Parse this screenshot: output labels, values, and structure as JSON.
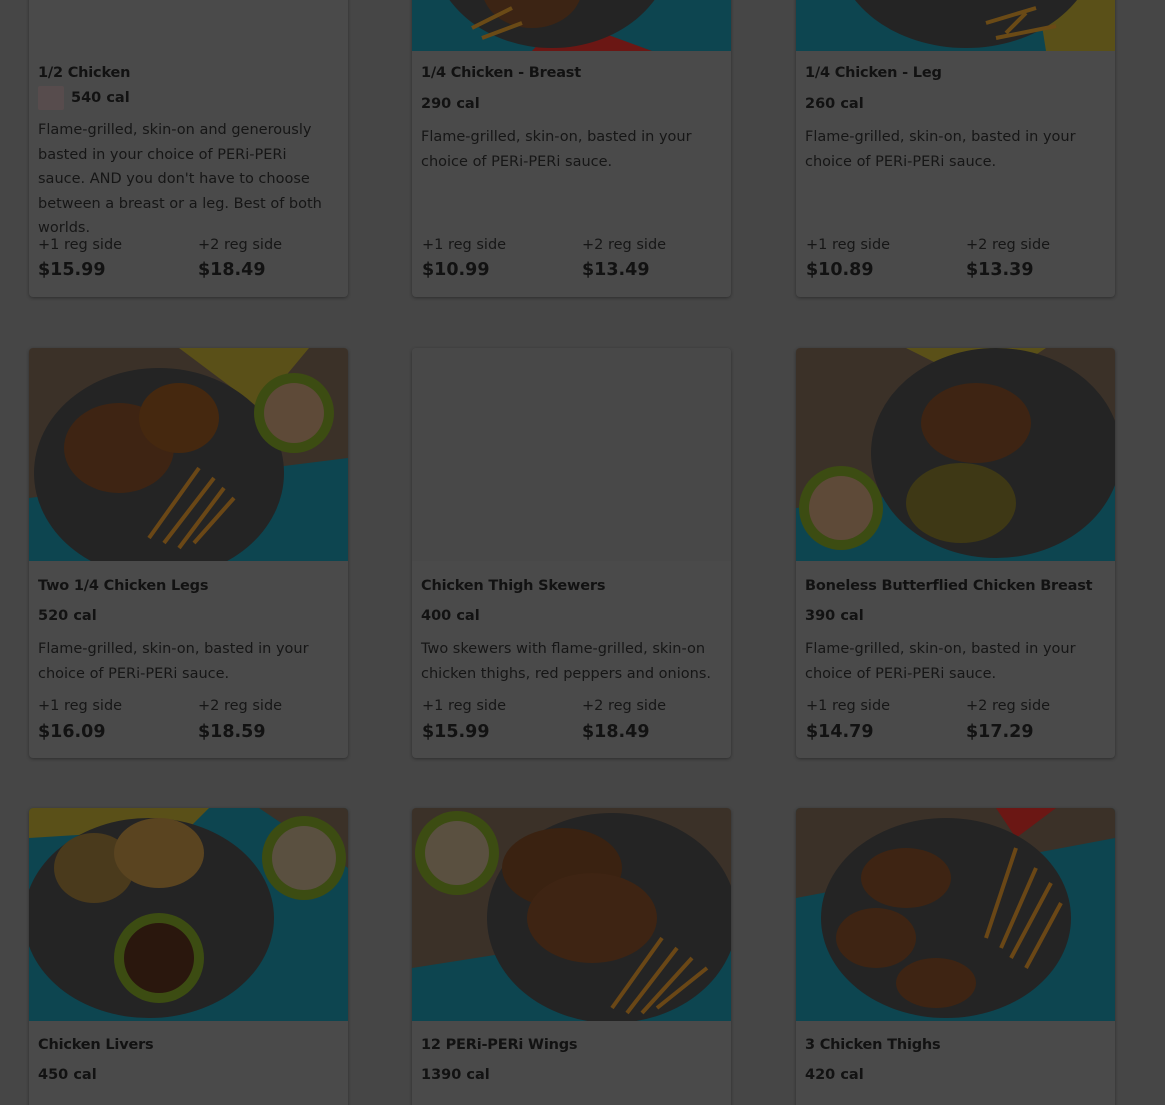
{
  "menu": {
    "items": [
      {
        "name": "1/2 Chicken",
        "calories": "540 cal",
        "description": "Flame-grilled, skin-on and generously basted in your choice of PERi-PERi sauce. AND you don't have to choose between a breast or a leg. Best of both worlds.",
        "option1_label": "+1 reg side",
        "option1_price": "$15.99",
        "option2_label": "+2 reg side",
        "option2_price": "$18.49"
      },
      {
        "name": "1/4 Chicken - Breast",
        "calories": "290 cal",
        "description": "Flame-grilled, skin-on, basted in your choice of PERi-PERi sauce.",
        "option1_label": "+1 reg side",
        "option1_price": "$10.99",
        "option2_label": "+2 reg side",
        "option2_price": "$13.49"
      },
      {
        "name": "1/4 Chicken - Leg",
        "calories": "260 cal",
        "description": "Flame-grilled, skin-on, basted in your choice of PERi-PERi sauce.",
        "option1_label": "+1 reg side",
        "option1_price": "$10.89",
        "option2_label": "+2 reg side",
        "option2_price": "$13.39"
      },
      {
        "name": "Two 1/4 Chicken Legs",
        "calories": "520 cal",
        "description": "Flame-grilled, skin-on, basted in your choice of PERi-PERi sauce.",
        "option1_label": "+1 reg side",
        "option1_price": "$16.09",
        "option2_label": "+2 reg side",
        "option2_price": "$18.59"
      },
      {
        "name": "Chicken Thigh Skewers",
        "calories": "400 cal",
        "description": "Two skewers with flame-grilled, skin-on chicken thighs, red peppers and onions.",
        "option1_label": "+1 reg side",
        "option1_price": "$15.99",
        "option2_label": "+2 reg side",
        "option2_price": "$18.49"
      },
      {
        "name": "Boneless Butterflied Chicken Breast",
        "calories": "390 cal",
        "description": "Flame-grilled, skin-on, basted in your choice of PERi-PERi sauce.",
        "option1_label": "+1 reg side",
        "option1_price": "$14.79",
        "option2_label": "+2 reg side",
        "option2_price": "$17.29"
      },
      {
        "name": "Chicken Livers",
        "calories": "450 cal"
      },
      {
        "name": "12 PERi-PERi Wings",
        "calories": "1390 cal"
      },
      {
        "name": "3 Chicken Thighs",
        "calories": "420 cal"
      }
    ]
  },
  "colors": {
    "overlay_background": "#464646",
    "card_background": "#4a4a4a",
    "text": "#121212"
  }
}
